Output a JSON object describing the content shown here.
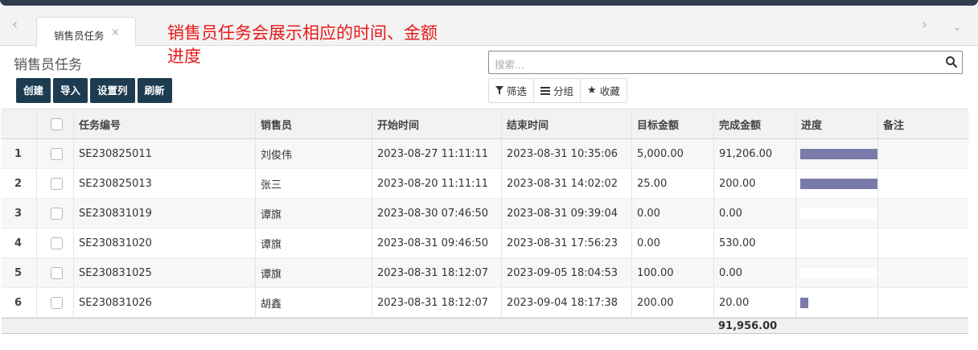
{
  "tab": {
    "label": "销售员任务",
    "close": "×"
  },
  "annotation": {
    "line1": "销售员任务会展示相应的时间、金额",
    "line2": "进度"
  },
  "page": {
    "title": "销售员任务"
  },
  "toolbar": {
    "create": "创建",
    "import": "导入",
    "set_columns": "设置列",
    "refresh": "刷新"
  },
  "search": {
    "placeholder": "搜索..."
  },
  "filters": {
    "filter": "筛选",
    "group": "分组",
    "favorite": "收藏"
  },
  "table": {
    "headers": {
      "task_no": "任务编号",
      "salesperson": "销售员",
      "start": "开始时间",
      "end": "结束时间",
      "target": "目标金额",
      "done": "完成金额",
      "progress": "进度",
      "note": "备注"
    },
    "rows": [
      {
        "n": "1",
        "task_no": "SE230825011",
        "salesperson": "刘俊伟",
        "start": "2023-08-27 11:11:11",
        "end": "2023-08-31 10:35:06",
        "target": "5,000.00",
        "done": "91,206.00",
        "progress": 1.0
      },
      {
        "n": "2",
        "task_no": "SE230825013",
        "salesperson": "张三",
        "start": "2023-08-20 11:11:11",
        "end": "2023-08-31 14:02:02",
        "target": "25.00",
        "done": "200.00",
        "progress": 1.0
      },
      {
        "n": "3",
        "task_no": "SE230831019",
        "salesperson": "谭旗",
        "start": "2023-08-30 07:46:50",
        "end": "2023-08-31 09:39:04",
        "target": "0.00",
        "done": "0.00",
        "progress": 0
      },
      {
        "n": "4",
        "task_no": "SE230831020",
        "salesperson": "谭旗",
        "start": "2023-08-31 09:46:50",
        "end": "2023-08-31 17:56:23",
        "target": "0.00",
        "done": "530.00",
        "progress": 0
      },
      {
        "n": "5",
        "task_no": "SE230831025",
        "salesperson": "谭旗",
        "start": "2023-08-31 18:12:07",
        "end": "2023-09-05 18:04:53",
        "target": "100.00",
        "done": "0.00",
        "progress": 0
      },
      {
        "n": "6",
        "task_no": "SE230831026",
        "salesperson": "胡鑫",
        "start": "2023-08-31 18:12:07",
        "end": "2023-09-04 18:17:38",
        "target": "200.00",
        "done": "20.00",
        "progress": 0.1
      }
    ],
    "total_done": "91,956.00"
  },
  "colors": {
    "topbar": "#2f3d4d",
    "button": "#1d3b51",
    "progress": "#7b7bab",
    "annotation": "#e8191a"
  }
}
